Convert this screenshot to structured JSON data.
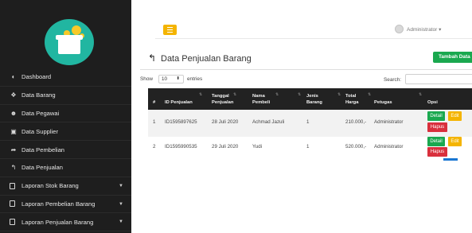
{
  "sidebar": {
    "items": [
      {
        "label": "Dashboard",
        "icon": "dashboard-icon",
        "glyph": "◐"
      },
      {
        "label": "Data Barang",
        "icon": "boxes-icon",
        "glyph": "❖"
      },
      {
        "label": "Data Pegawai",
        "icon": "users-icon",
        "glyph": "☻"
      },
      {
        "label": "Data Supplier",
        "icon": "truck-icon",
        "glyph": "▣"
      },
      {
        "label": "Data Pembelian",
        "icon": "forward-icon",
        "glyph": "➦"
      },
      {
        "label": "Data Penjualan",
        "icon": "reply-icon",
        "glyph": "↰"
      },
      {
        "label": "Laporan Stok Barang",
        "icon": "document-icon",
        "caret": "▼"
      },
      {
        "label": "Laporan Pembelian Barang",
        "icon": "document-icon",
        "caret": "▼"
      },
      {
        "label": "Laporan Penjualan Barang",
        "icon": "document-icon",
        "caret": "▼"
      }
    ]
  },
  "topbar": {
    "user_name": "Administrator ▾"
  },
  "page": {
    "title": "Data Penjualan Barang",
    "add_button": "Tambah Data"
  },
  "controls": {
    "show_label": "Show",
    "entries_value": "10",
    "entries_arrow": "⬍",
    "entries_label": "entries",
    "search_label": "Search:"
  },
  "table": {
    "headers": {
      "no": "#",
      "id_line1": "ID Penjualan",
      "tgl_line1": "Tanggal",
      "tgl_line2": "Penjualan",
      "nama_line1": "Nama",
      "nama_line2": "Pembeli",
      "jenis_line1": "Jenis",
      "jenis_line2": "Barang",
      "total_line1": "Total",
      "total_line2": "Harga",
      "petugas": "Petugas",
      "opsi": "Opsi"
    },
    "sort_glyph": "⇅",
    "rows": [
      {
        "no": "1",
        "id": "ID1595897625",
        "tanggal": "28 Juli 2020",
        "nama": "Achmad Jazuli",
        "jenis": "1",
        "total": "210.000,-",
        "petugas": "Administrator"
      },
      {
        "no": "2",
        "id": "ID1595990535",
        "tanggal": "29 Juli 2020",
        "nama": "Yudi",
        "jenis": "1",
        "total": "520.000,-",
        "petugas": "Administrator"
      }
    ],
    "buttons": {
      "detail": "Detail",
      "edit": "Edit",
      "hapus": "Hapus"
    }
  }
}
